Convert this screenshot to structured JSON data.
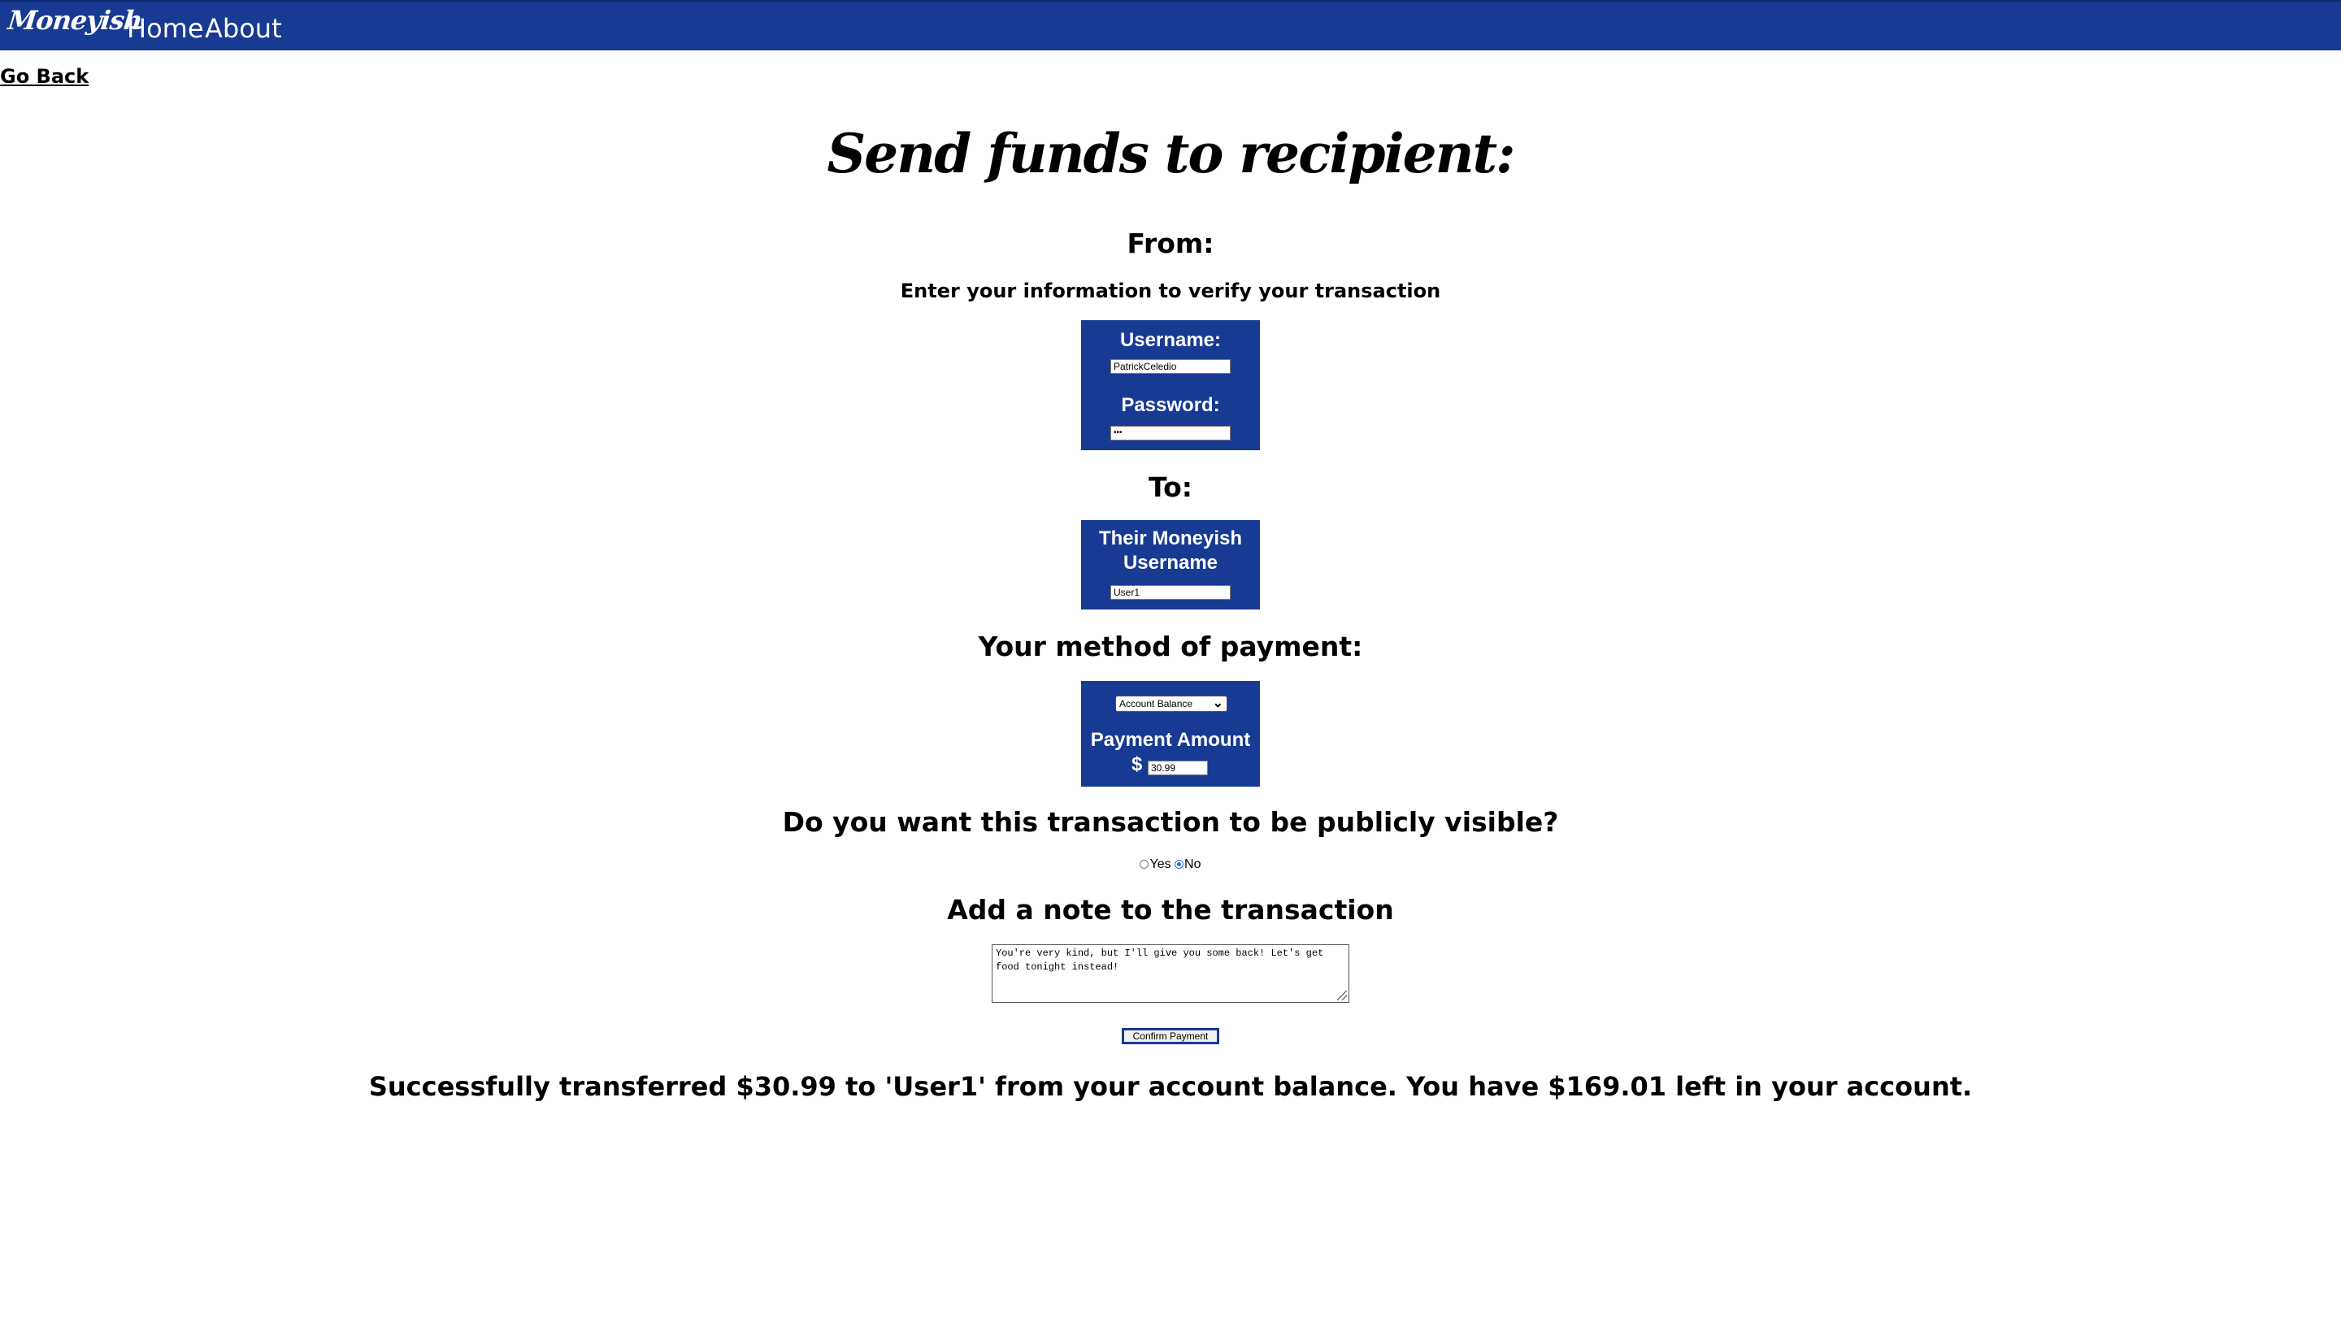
{
  "nav": {
    "brand": "Moneyish",
    "home": "Home",
    "about": "About"
  },
  "go_back": "Go Back",
  "page": {
    "title": "Send funds to recipient:",
    "from_heading": "From:",
    "verify_text": "Enter your information to verify your transaction",
    "to_heading": "To:",
    "method_heading": "Your method of payment:",
    "public_heading": "Do you want this transaction to be publicly visible?",
    "note_heading": "Add a note to the transaction",
    "success_message": "Successfully transferred $30.99 to 'User1' from your account balance. You have $169.01 left in your account."
  },
  "from_box": {
    "username_label": "Username:",
    "username_value": "PatrickCeledio",
    "password_label": "Password:",
    "password_value": "•••"
  },
  "to_box": {
    "label_line1": "Their Moneyish",
    "label_line2": "Username",
    "username_value": "User1"
  },
  "payment_box": {
    "method_selected": "Account Balance",
    "amount_label": "Payment Amount",
    "currency_symbol": "$",
    "amount_value": "30.99"
  },
  "visibility": {
    "yes_label": "Yes",
    "no_label": "No",
    "selected": "No"
  },
  "note": {
    "text": "You're very kind, but I'll give you some back! Let's get food tonight instead!"
  },
  "confirm_label": "Confirm Payment",
  "colors": {
    "brand_blue": "#173a92",
    "radio_accent": "#2a6bd9"
  }
}
